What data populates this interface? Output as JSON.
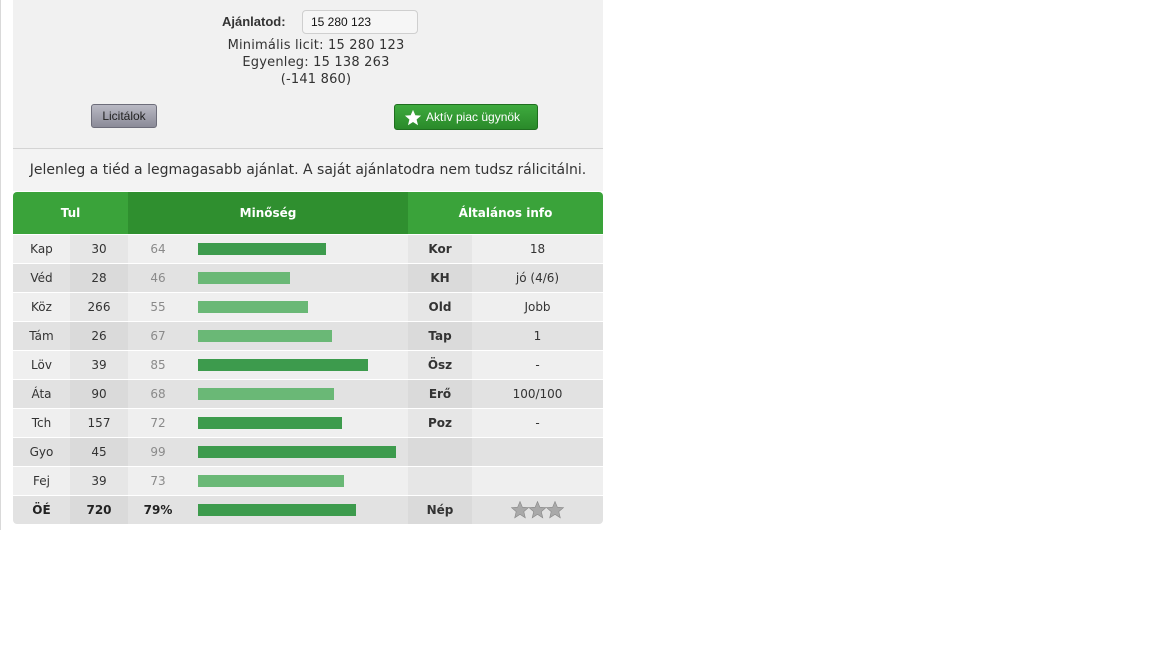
{
  "colors": {
    "header_green": "#3aa33a",
    "header_green_dark": "#2f8f2f",
    "bar_dark": "#3d9b4d",
    "bar_light": "#6ab876",
    "row_light": "#efefef",
    "row_dark": "#e2e2e2"
  },
  "bid": {
    "label": "Ajánlatod:",
    "input_value": "15 280 123",
    "min_bid": "Minimális licit: 15 280 123",
    "balance": "Egyenleg: 15 138 263",
    "difference": "(-141 860)"
  },
  "buttons": {
    "bids_label": "Licitálok",
    "agent_label": "Aktív piac ügynök",
    "agent_icon": "star-icon"
  },
  "notice": "Jelenleg a tiéd a legmagasabb ajánlat. A saját ajánlatodra nem tudsz rálicitálni.",
  "table": {
    "headers": [
      "Tul",
      "Minőség",
      "Általános info"
    ],
    "rows": [
      {
        "name": "Kap",
        "value": "30",
        "quality": "64",
        "bar_pct": 64,
        "info_key": "Kor",
        "info_val": "18"
      },
      {
        "name": "Véd",
        "value": "28",
        "quality": "46",
        "bar_pct": 46,
        "info_key": "KH",
        "info_val": "jó (4/6)"
      },
      {
        "name": "Köz",
        "value": "266",
        "quality": "55",
        "bar_pct": 55,
        "info_key": "Old",
        "info_val": "Jobb"
      },
      {
        "name": "Tám",
        "value": "26",
        "quality": "67",
        "bar_pct": 67,
        "info_key": "Tap",
        "info_val": "1"
      },
      {
        "name": "Löv",
        "value": "39",
        "quality": "85",
        "bar_pct": 85,
        "info_key": "Ösz",
        "info_val": "-"
      },
      {
        "name": "Áta",
        "value": "90",
        "quality": "68",
        "bar_pct": 68,
        "info_key": "Erő",
        "info_val": "100/100"
      },
      {
        "name": "Tch",
        "value": "157",
        "quality": "72",
        "bar_pct": 72,
        "info_key": "Poz",
        "info_val": "-"
      },
      {
        "name": "Gyo",
        "value": "45",
        "quality": "99",
        "bar_pct": 99,
        "info_key": "",
        "info_val": ""
      },
      {
        "name": "Fej",
        "value": "39",
        "quality": "73",
        "bar_pct": 73,
        "info_key": "",
        "info_val": ""
      }
    ],
    "total": {
      "name": "ÖÉ",
      "value": "720",
      "quality": "79%",
      "bar_pct": 79,
      "info_key": "Nép",
      "stars": 3,
      "star_icon": "star-rating-icon"
    }
  }
}
